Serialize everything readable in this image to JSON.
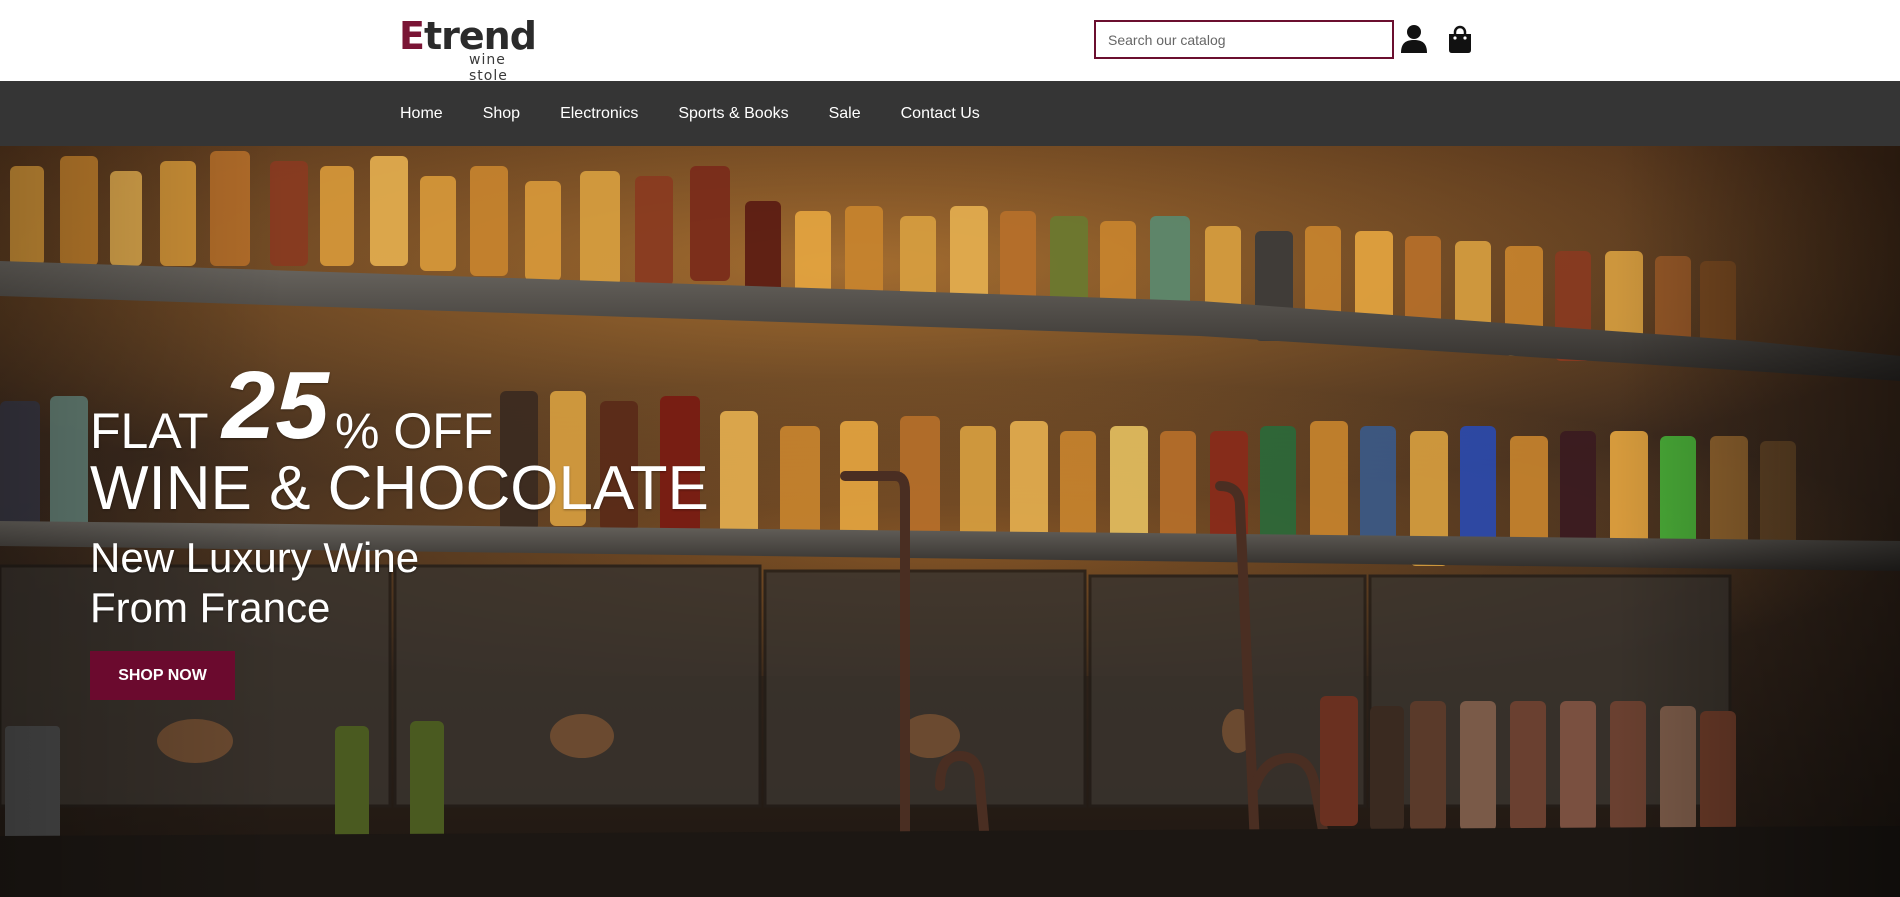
{
  "header": {
    "logo": {
      "main": "Etrend",
      "main_first": "E",
      "main_rest": "trend",
      "sub": "wine stole"
    },
    "search": {
      "placeholder": "Search our catalog",
      "value": ""
    },
    "icons": [
      "user-icon",
      "shopping-bag-icon"
    ]
  },
  "nav": {
    "items": [
      {
        "label": "Home"
      },
      {
        "label": "Shop"
      },
      {
        "label": "Electronics"
      },
      {
        "label": "Sports & Books"
      },
      {
        "label": "Sale"
      },
      {
        "label": "Contact Us"
      }
    ]
  },
  "hero": {
    "flat": "FLAT",
    "number": "25",
    "percent_off": "% OFF",
    "headline": "WINE & CHOCOLATE",
    "tagline_1": "New Luxury Wine",
    "tagline_2": "From France",
    "cta": "SHOP NOW"
  },
  "colors": {
    "brand": "#6b0a2e",
    "nav_bg": "#353535",
    "logo_accent": "#7a1535"
  }
}
